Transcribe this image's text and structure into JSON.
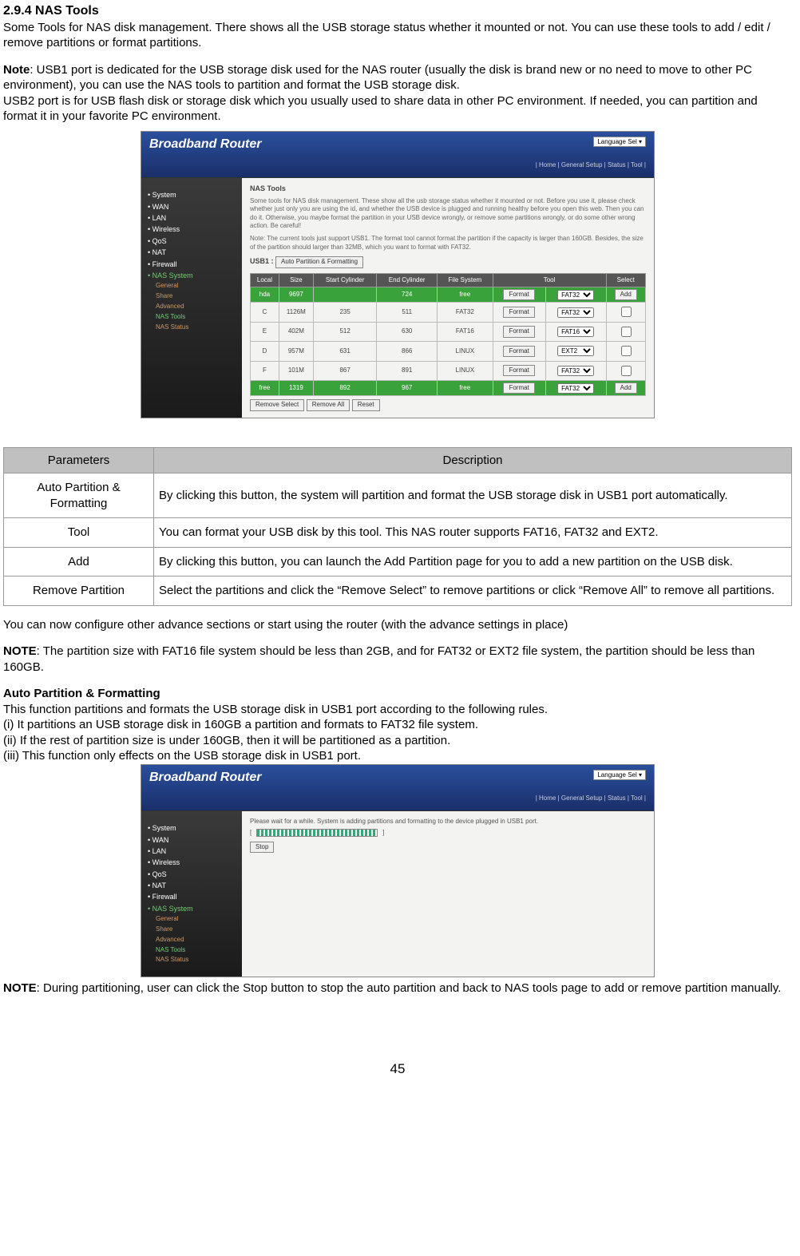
{
  "heading": "2.9.4 NAS Tools",
  "intro1": "Some Tools for NAS disk management. There shows all the USB storage status whether it mounted or not. You can use these tools to add / edit / remove partitions or format partitions.",
  "note_label": "Note",
  "note_text": ": USB1 port is dedicated for the USB storage disk used for the NAS router (usually the disk is brand new or no need to move to other PC environment), you can use the NAS tools to partition and format the USB storage disk.",
  "note_text2": "USB2 port is for USB flash disk or storage disk which you usually used to share data in other PC environment. If needed, you can partition and format it in your favorite PC environment.",
  "router1": {
    "title": "Broadband Router",
    "lang_label": "Language",
    "lang_value": "Sel",
    "breadcrumb": "| Home | General Setup | Status | Tool |",
    "nav": {
      "items": [
        "System",
        "WAN",
        "LAN",
        "Wireless",
        "QoS",
        "NAT",
        "Firewall",
        "NAS System"
      ],
      "subs": [
        "General",
        "Share",
        "Advanced",
        "NAS Tools",
        "NAS Status"
      ]
    },
    "section_title": "NAS Tools",
    "blurb1": "Some tools for NAS disk management. These show all the usb storage status whether it mounted or not. Before you use it, please check whether just only you are using the id, and whether the USB device is plugged and running healthy before you open this web. Then you can do it. Otherwise, you maybe format the partition in your USB device wrongly, or remove some partitions wrongly, or do some other wrong action. Be careful!",
    "blurb2": "Note: The current tools just support USB1. The format tool cannot format the partition if the capacity is larger than 160GB. Besides, the size of the partition should larger than 32MB, which you want to format with FAT32.",
    "usb_label": "USB1 :",
    "auto_btn": "Auto Partition & Formatting",
    "table_headers": [
      "Local",
      "Size",
      "Start Cylinder",
      "End Cylinder",
      "File System",
      "Tool",
      "Select"
    ],
    "rows": [
      {
        "local": "hda",
        "size": "9697",
        "start": "",
        "end": "724",
        "fs": "free",
        "tool": "Format",
        "fmt": "FAT32",
        "select": "Add",
        "green": true
      },
      {
        "local": "C",
        "size": "1126M",
        "start": "235",
        "end": "511",
        "fs": "FAT32",
        "tool": "Format",
        "fmt": "FAT32",
        "select": "",
        "green": false
      },
      {
        "local": "E",
        "size": "402M",
        "start": "512",
        "end": "630",
        "fs": "FAT16",
        "tool": "Format",
        "fmt": "FAT16",
        "select": "",
        "green": false
      },
      {
        "local": "D",
        "size": "957M",
        "start": "631",
        "end": "866",
        "fs": "LINUX",
        "tool": "Format",
        "fmt": "EXT2",
        "select": "",
        "green": false
      },
      {
        "local": "F",
        "size": "101M",
        "start": "867",
        "end": "891",
        "fs": "LINUX",
        "tool": "Format",
        "fmt": "FAT32",
        "select": "",
        "green": false
      },
      {
        "local": "free",
        "size": "1319",
        "start": "892",
        "end": "967",
        "fs": "free",
        "tool": "Format",
        "fmt": "FAT32",
        "select": "Add",
        "green": true
      }
    ],
    "under_btns": [
      "Remove Select",
      "Remove All",
      "Reset"
    ]
  },
  "chart_data": {
    "type": "table",
    "headers": [
      "Parameters",
      "Description"
    ],
    "rows": [
      {
        "param": "Auto Partition & Formatting",
        "desc": "By clicking this button, the system will partition and format the USB storage disk in USB1 port automatically."
      },
      {
        "param": "Tool",
        "desc": "You can format your USB disk by this tool. This NAS router supports FAT16, FAT32 and EXT2."
      },
      {
        "param": "Add",
        "desc": "By clicking this button, you can launch the Add Partition page for you to add a new partition on the USB disk."
      },
      {
        "param": "Remove Partition",
        "desc": "Select the partitions and click the “Remove Select” to remove partitions or click “Remove All” to remove all partitions."
      }
    ]
  },
  "after_table1": "You can now configure other advance sections or start using the router (with the advance settings in place)",
  "note2_label": "NOTE",
  "note2_text": ": The partition size with FAT16 file system should be less than 2GB, and for FAT32 or EXT2 file system, the partition should be less than 160GB.",
  "auto_heading": "Auto Partition & Formatting",
  "auto_line1": "This function partitions and formats the USB storage disk in USB1 port according to the following rules.",
  "auto_line2": "(i) It partitions an USB storage disk in 160GB a partition and formats to FAT32 file system.",
  "auto_line3": "(ii) If the rest of partition size is under 160GB, then it will be partitioned as a partition.",
  "auto_line4": "(iii) This function only effects on the USB storage disk in USB1 port.",
  "router2": {
    "progress_text": "Please wait for a while. System is adding partitions and formatting to the device plugged in USB1 port.",
    "stop_btn": "Stop"
  },
  "note3_label": "NOTE",
  "note3_text": ": During partitioning, user can click the Stop button to stop the auto partition and back to NAS tools page to add or remove partition manually.",
  "page_number": "45"
}
